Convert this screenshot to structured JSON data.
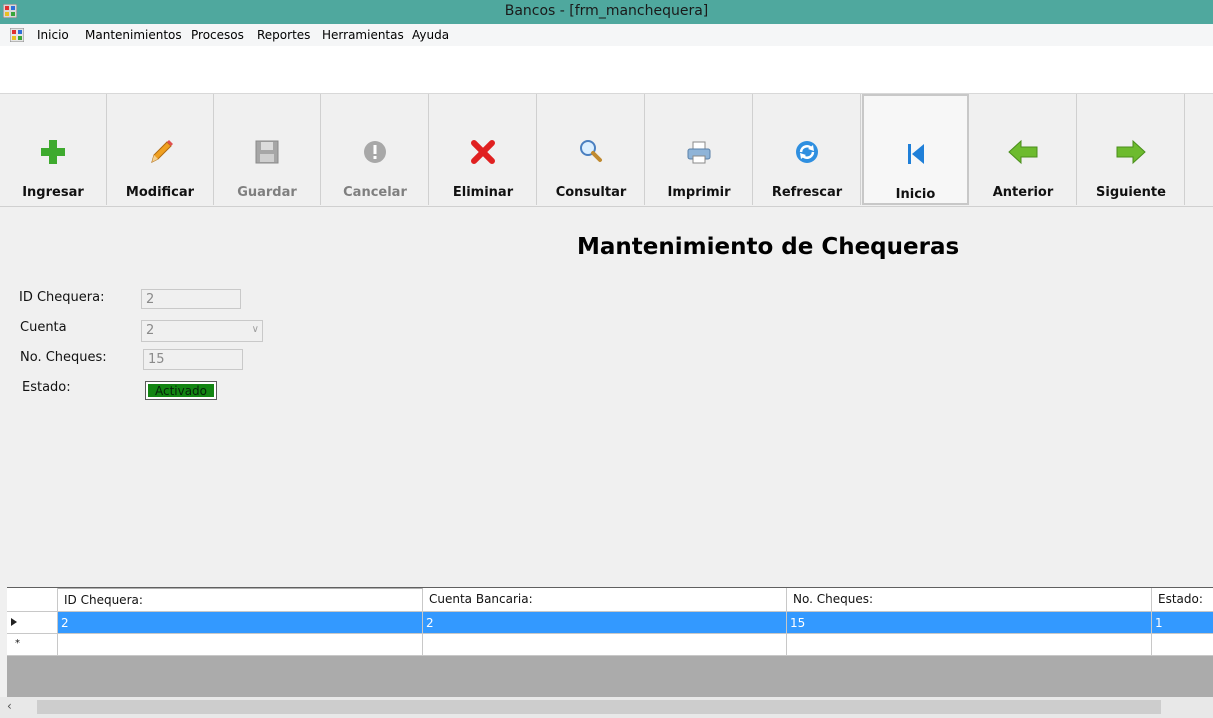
{
  "window": {
    "title": "Bancos - [frm_manchequera]"
  },
  "menu": [
    "Inicio",
    "Mantenimientos",
    "Procesos",
    "Reportes",
    "Herramientas",
    "Ayuda"
  ],
  "toolbar": [
    {
      "label": "Ingresar",
      "icon": "plus-icon",
      "enabled": true
    },
    {
      "label": "Modificar",
      "icon": "pencil-icon",
      "enabled": true
    },
    {
      "label": "Guardar",
      "icon": "save-icon",
      "enabled": false
    },
    {
      "label": "Cancelar",
      "icon": "cancel-icon",
      "enabled": false
    },
    {
      "label": "Eliminar",
      "icon": "delete-x-icon",
      "enabled": true
    },
    {
      "label": "Consultar",
      "icon": "magnifier-icon",
      "enabled": true
    },
    {
      "label": "Imprimir",
      "icon": "printer-icon",
      "enabled": true
    },
    {
      "label": "Refrescar",
      "icon": "refresh-icon",
      "enabled": true
    },
    {
      "label": "Inicio",
      "icon": "first-record-icon",
      "enabled": true
    },
    {
      "label": "Anterior",
      "icon": "arrow-left-icon",
      "enabled": true
    },
    {
      "label": "Siguiente",
      "icon": "arrow-right-icon",
      "enabled": true
    }
  ],
  "form": {
    "heading": "Mantenimiento de Chequeras",
    "id_label": "ID Chequera:",
    "id_value": "2",
    "cuenta_label": "Cuenta",
    "cuenta_value": "2",
    "cheques_label": "No. Cheques:",
    "cheques_value": "15",
    "estado_label": "Estado:",
    "estado_value": "Activado"
  },
  "grid": {
    "columns": [
      "ID Chequera:",
      "Cuenta Bancaria:",
      "No. Cheques:",
      "Estado:"
    ],
    "rows": [
      [
        "2",
        "2",
        "15",
        "1"
      ]
    ],
    "selected_color": "#3399ff"
  },
  "colors": {
    "titlebar": "#4fa89e",
    "estado_bg": "#128512"
  }
}
